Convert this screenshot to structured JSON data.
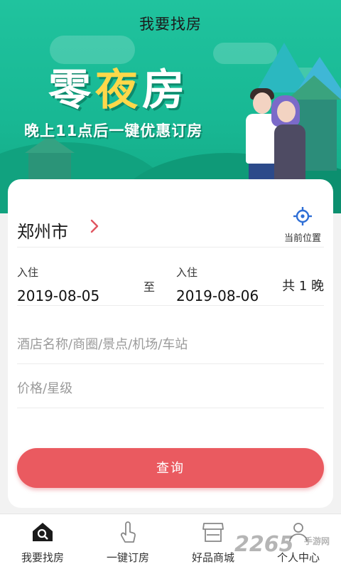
{
  "header": {
    "title": "我要找房"
  },
  "banner": {
    "slogan_part1": "零",
    "slogan_part2": "夜",
    "slogan_part3": "房",
    "subslogan": "晚上11点后一键优惠订房"
  },
  "search": {
    "city": "郑州市",
    "location_label": "当前位置",
    "checkin_label": "入住",
    "checkin_date": "2019-08-05",
    "separator": "至",
    "checkout_label": "入住",
    "checkout_date": "2019-08-06",
    "nights": "共 1 晚",
    "keyword_placeholder": "酒店名称/商圈/景点/机场/车站",
    "price_placeholder": "价格/星级",
    "query_button": "查询"
  },
  "nav": {
    "items": [
      {
        "label": "我要找房",
        "icon": "house-search-icon"
      },
      {
        "label": "一键订房",
        "icon": "tap-hand-icon"
      },
      {
        "label": "好品商城",
        "icon": "store-icon"
      },
      {
        "label": "个人中心",
        "icon": "user-icon"
      }
    ]
  },
  "watermark": {
    "number": "2265",
    "text": "手游网"
  },
  "colors": {
    "accent": "#ea5a60",
    "banner": "#1cbf99"
  }
}
